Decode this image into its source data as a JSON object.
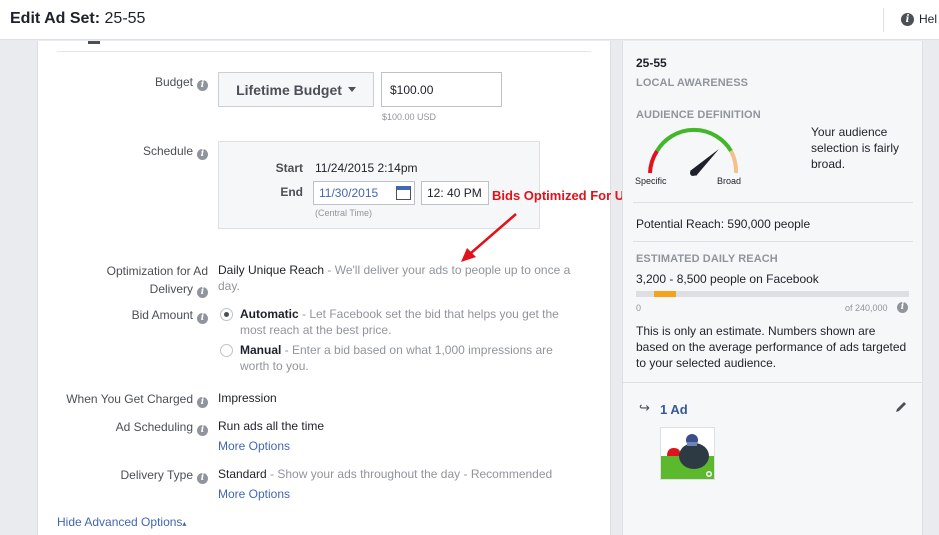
{
  "header": {
    "title_prefix": "Edit Ad Set:",
    "title_name": "25-55",
    "help_label": "Hel"
  },
  "form": {
    "budget": {
      "label": "Budget",
      "type_label": "Lifetime Budget",
      "amount": "$100.00",
      "amount_sub": "$100.00 USD"
    },
    "schedule": {
      "label": "Schedule",
      "start_label": "Start",
      "start_value": "11/24/2015 2:14pm",
      "end_label": "End",
      "end_date": "11/30/2015",
      "end_time": "12: 40 PM",
      "timezone": "(Central Time)"
    },
    "optimization": {
      "label_line1": "Optimization for Ad",
      "label_line2": "Delivery",
      "value": "Daily Unique Reach",
      "desc_line1": " - We'll deliver your ads to people up to once a",
      "desc_line2": "day."
    },
    "bid_amount": {
      "label": "Bid Amount",
      "automatic_title": "Automatic",
      "automatic_desc_line1": " - Let Facebook set the bid that helps you get the",
      "automatic_desc_line2": "most reach at the best price.",
      "manual_title": "Manual",
      "manual_desc_line1": " - Enter a bid based on what 1,000 impressions are",
      "manual_desc_line2": "worth to you.",
      "selected": "automatic"
    },
    "charged": {
      "label": "When You Get Charged",
      "value": "Impression"
    },
    "ad_scheduling": {
      "label": "Ad Scheduling",
      "value": "Run ads all the time",
      "link": "More Options"
    },
    "delivery_type": {
      "label": "Delivery Type",
      "value": "Standard",
      "desc": " - Show your ads throughout the day - Recommended",
      "link": "More Options"
    },
    "hide_advanced": "Hide Advanced Options"
  },
  "annotation": {
    "text": "Bids Optimized For Unique Daily Reach",
    "color": "#e0121b"
  },
  "sidebar": {
    "adset_name": "25-55",
    "objective": "LOCAL AWARENESS",
    "audience_definition_title": "AUDIENCE DEFINITION",
    "gauge_specific": "Specific",
    "gauge_broad": "Broad",
    "audience_text_line1": "Your audience",
    "audience_text_line2": "selection is fairly",
    "audience_text_line3": "broad.",
    "potential_reach": "Potential Reach: 590,000 people",
    "daily_reach_title": "ESTIMATED DAILY REACH",
    "daily_reach_value": "3,200 - 8,500 people on Facebook",
    "daily_reach_min_label": "0",
    "daily_reach_max_label": "of 240,000",
    "daily_reach_fraction_start": 0.0133,
    "daily_reach_fraction_end": 0.0354,
    "estimate_line1": "This is only an estimate. Numbers shown are",
    "estimate_line2": "based on the average performance of ads targeted",
    "estimate_line3": "to your selected audience.",
    "ads_count_label": "1 Ad"
  },
  "colors": {
    "link": "#4267b2",
    "bar": "#f7a21c",
    "gauge_red": "#e0121b",
    "gauge_green": "#42b72a",
    "gauge_orange": "#f7c08a"
  }
}
